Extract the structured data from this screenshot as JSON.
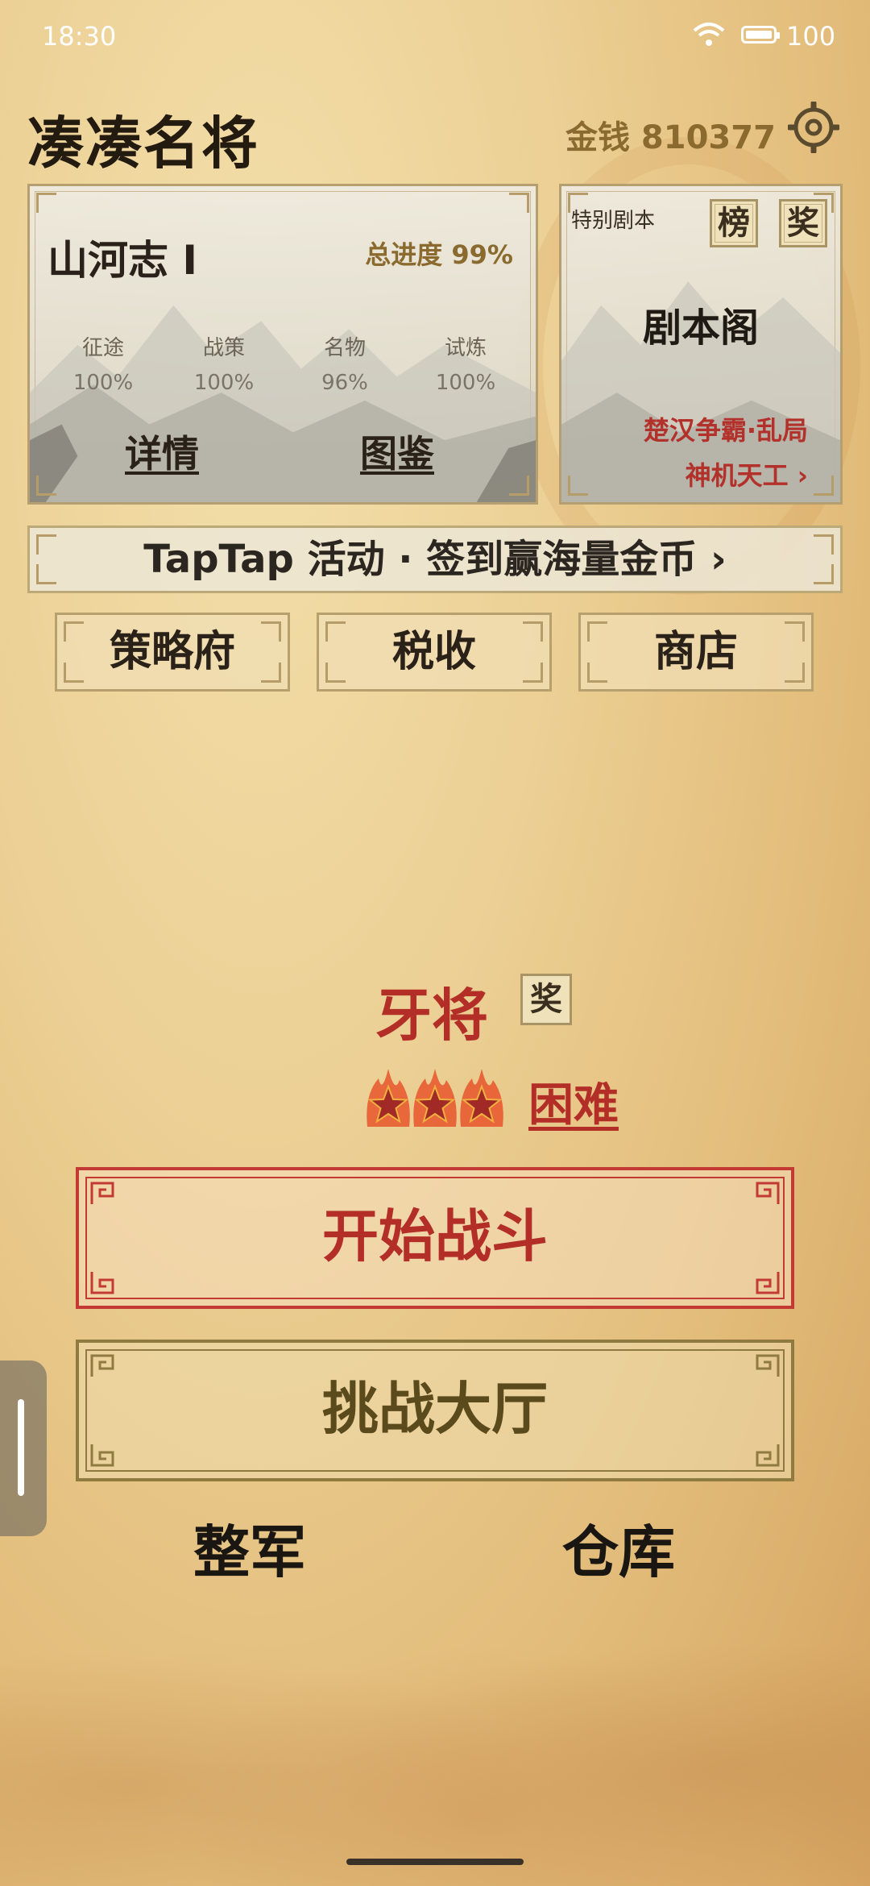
{
  "status_bar": {
    "time": "18:30",
    "battery": "100"
  },
  "header": {
    "title": "凑凑名将",
    "money": "金钱 810377"
  },
  "story_card": {
    "title": "山河志 I",
    "progress": "总进度 99%",
    "stats": [
      {
        "label": "征途",
        "value": "100%"
      },
      {
        "label": "战策",
        "value": "100%"
      },
      {
        "label": "名物",
        "value": "96%"
      },
      {
        "label": "试炼",
        "value": "100%"
      }
    ],
    "details_label": "详情",
    "codex_label": "图鉴"
  },
  "special_card": {
    "label": "特别剧本",
    "ranking_label": "榜",
    "reward_label": "奖",
    "main_label": "剧本阁",
    "scenario": "楚汉争霸·乱局",
    "sub_link": "神机天工 ›"
  },
  "banner": {
    "text": "TapTap 活动 · 签到赢海量金币 ›"
  },
  "menu": {
    "strategy": "策略府",
    "tax": "税收",
    "shop": "商店"
  },
  "battle": {
    "rank": "牙将",
    "rank_reward": "奖",
    "star_count": 3,
    "difficulty": "困难",
    "start_label": "开始战斗",
    "challenge_label": "挑战大厅"
  },
  "bottom": {
    "army": "整军",
    "warehouse": "仓库"
  }
}
